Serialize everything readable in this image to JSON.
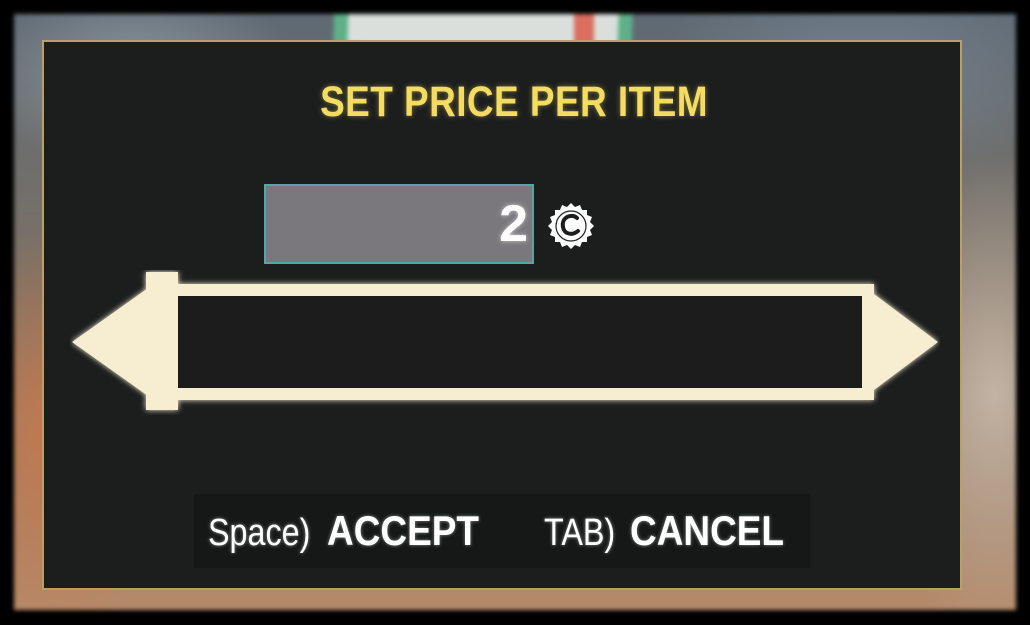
{
  "dialog": {
    "title": "SET PRICE PER ITEM",
    "price_value": "2",
    "currency_icon": "bottle-cap-icon",
    "slider_level": 0
  },
  "hints": {
    "accept_key": "Space)",
    "accept_label": "ACCEPT",
    "cancel_key": "TAB)",
    "cancel_label": "CANCEL"
  },
  "colors": {
    "title": "#f4dc62",
    "frame_border": "#b8a067",
    "slider_glow": "#f7eed2",
    "price_box_fill": "#7b787d",
    "price_box_border": "#57a3a8",
    "dialog_bg": "#1c1e1e"
  }
}
